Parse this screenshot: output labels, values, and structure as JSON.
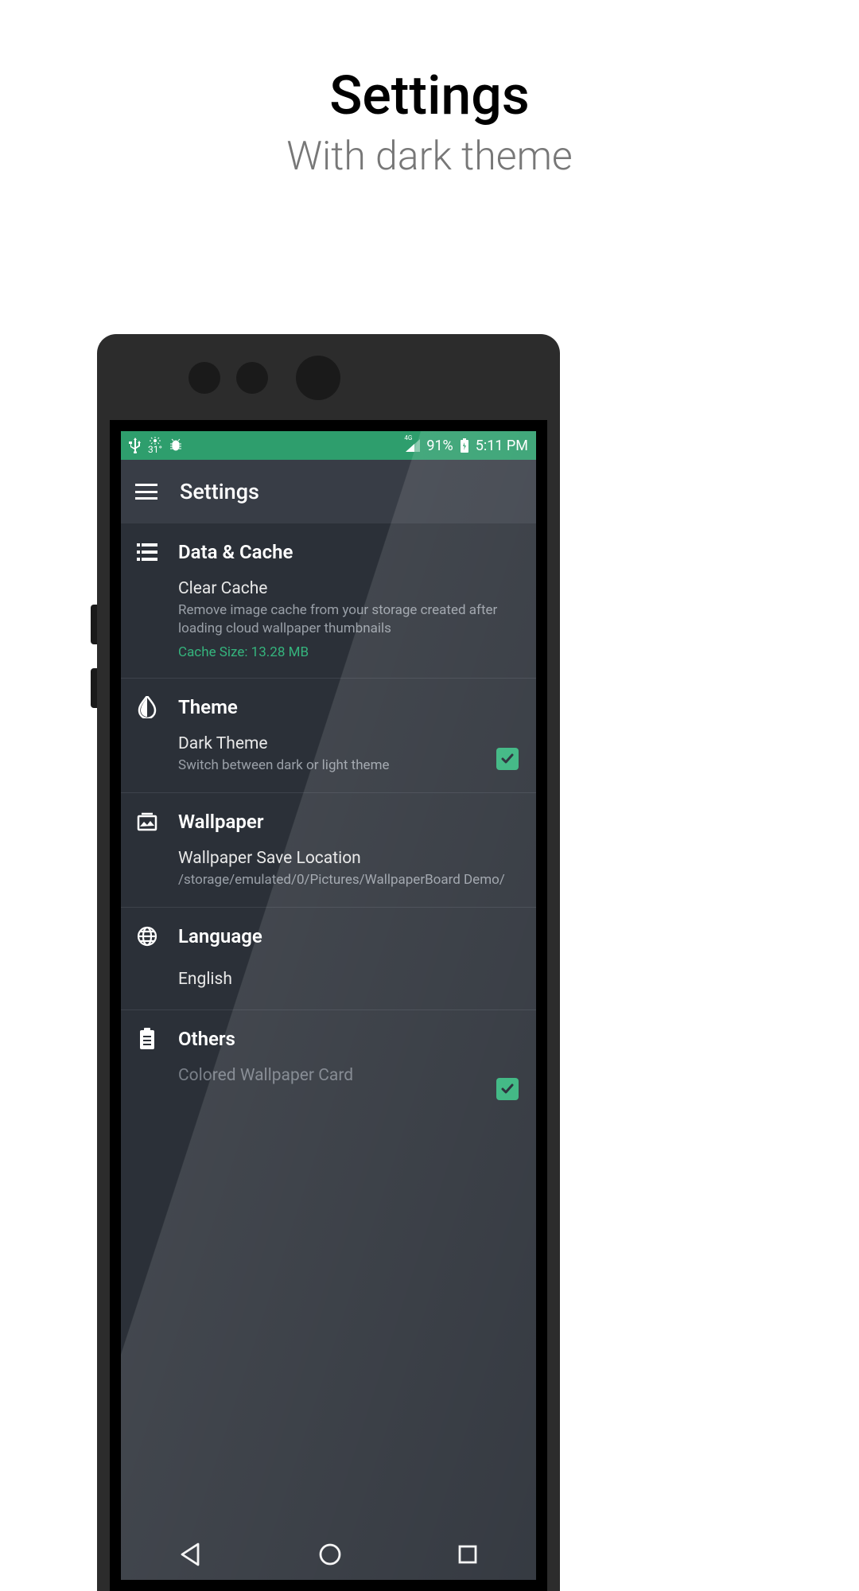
{
  "promo": {
    "title": "Settings",
    "subtitle": "With dark theme"
  },
  "status": {
    "temp": "31°",
    "signal_label": "4G",
    "battery_pct": "91%",
    "time": "5:11 PM"
  },
  "appbar": {
    "title": "Settings"
  },
  "sections": {
    "data_cache": {
      "title": "Data & Cache",
      "clear_cache": {
        "title": "Clear Cache",
        "desc": "Remove image cache from your storage created after loading cloud wallpaper thumbnails",
        "cache_size": "Cache Size: 13.28 MB"
      }
    },
    "theme": {
      "title": "Theme",
      "dark": {
        "title": "Dark Theme",
        "desc": "Switch between dark or light theme",
        "checked": true
      }
    },
    "wallpaper": {
      "title": "Wallpaper",
      "save_loc": {
        "title": "Wallpaper Save Location",
        "path": "/storage/emulated/0/Pictures/WallpaperBoard Demo/"
      }
    },
    "language": {
      "title": "Language",
      "value": "English"
    },
    "others": {
      "title": "Others",
      "colored_card": {
        "title": "Colored Wallpaper Card",
        "checked": true
      }
    }
  },
  "colors": {
    "accent": "#35b47d"
  }
}
